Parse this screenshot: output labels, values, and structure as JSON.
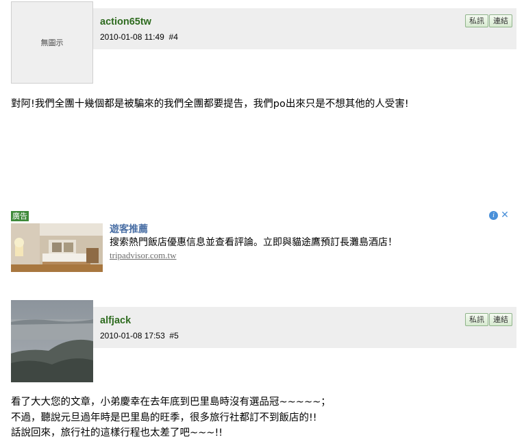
{
  "posts": [
    {
      "author": "action65tw",
      "date": "2010-01-08 11:49",
      "floor": "#4",
      "avatar_text": "無圖示",
      "pm_label": "私訊",
      "link_label": "連結",
      "lines": [
        "對阿!我們全團十幾個都是被騙來的我們全團都要提告，我們po出來只是不想其他的人受害!"
      ]
    },
    {
      "author": "alfjack",
      "date": "2010-01-08 17:53",
      "floor": "#5",
      "pm_label": "私訊",
      "link_label": "連結",
      "lines": [
        "看了大大您的文章，小弟慶幸在去年底到巴里島時沒有選品冠~~~~~；",
        "不過，聽說元旦過年時是巴里島的旺季，很多旅行社都訂不到飯店的!!",
        "話說回來，旅行社的這樣行程也太差了吧~~~!!"
      ]
    }
  ],
  "ad": {
    "badge": "廣告",
    "title": "遊客推薦",
    "description": "搜索熱門飯店優惠信息並查看評論。立即與貓途鷹預訂長灘島酒店！",
    "url": "tripadvisor.com.tw",
    "info_glyph": "i",
    "close_glyph": "✕"
  }
}
